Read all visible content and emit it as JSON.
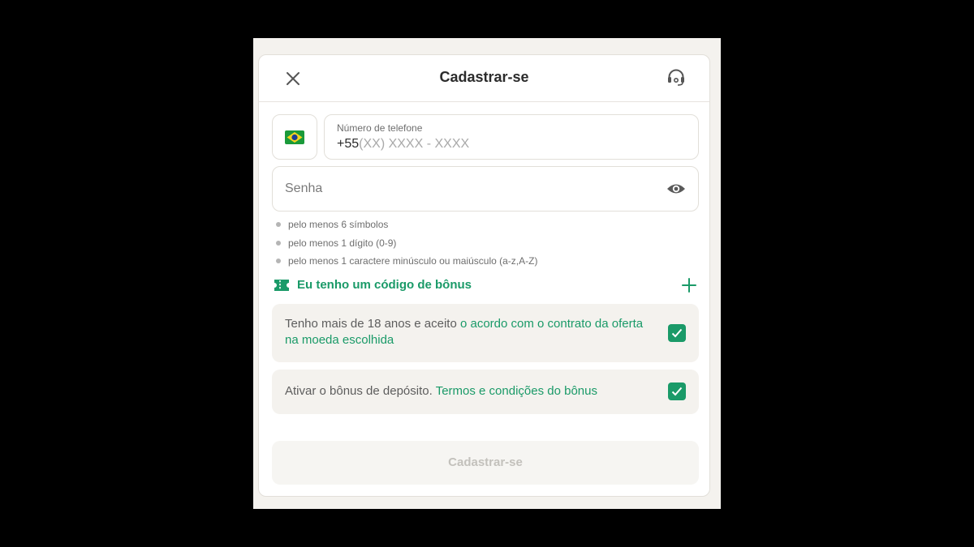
{
  "header": {
    "title": "Cadastrar-se",
    "close_icon": "close-icon",
    "support_icon": "headset-support-icon"
  },
  "phone": {
    "country_flag": "brazil-flag-icon",
    "label": "Número de telefone",
    "prefix": "+55",
    "placeholder": "(XX) XXXX - XXXX"
  },
  "password": {
    "placeholder": "Senha",
    "toggle_icon": "eye-icon",
    "rules": [
      "pelo menos 6 símbolos",
      "pelo menos 1 dígito (0-9)",
      "pelo menos 1 caractere minúsculo ou maiúsculo (a-z,A-Z)"
    ]
  },
  "bonus_code": {
    "label": "Eu tenho um código de bônus",
    "icon": "ticket-icon",
    "expand_icon": "plus-icon"
  },
  "agreements": [
    {
      "text": "Tenho mais de 18 anos e aceito ",
      "link": "o acordo com o contrato da oferta na moeda escolhida",
      "checked": true
    },
    {
      "text": "Ativar o bônus de depósito. ",
      "link": "Termos e condições do bônus",
      "checked": true
    }
  ],
  "submit": {
    "label": "Cadastrar-se",
    "enabled": false
  },
  "colors": {
    "accent": "#1a9a68",
    "page_background": "#000000",
    "panel_background": "#f4f2ee",
    "card_background": "#ffffff",
    "disabled_text": "#c3c1bc"
  }
}
